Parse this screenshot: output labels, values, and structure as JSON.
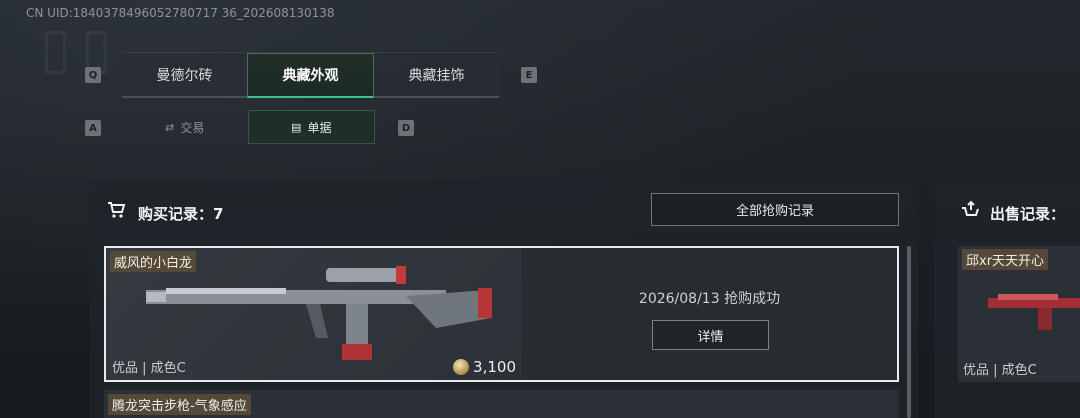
{
  "uid": "CN UID 1840378496052780717 36_202608130138",
  "uid_text": "CN UID:1840378496052780717 36_202608130138",
  "keys": {
    "q": "Q",
    "e": "E",
    "a": "A",
    "d": "D"
  },
  "tabs": [
    {
      "label": "曼德尔砖"
    },
    {
      "label": "典藏外观"
    },
    {
      "label": "典藏挂饰"
    }
  ],
  "subtabs": [
    {
      "label": "交易",
      "icon": "trade-icon"
    },
    {
      "label": "单据",
      "icon": "document-icon"
    }
  ],
  "purchase": {
    "title": "购买记录：7",
    "all_button": "全部抢购记录",
    "records": [
      {
        "name": "威风的小白龙",
        "quality": "优品 | 成色C",
        "price": "3,100",
        "status": "2026/08/13 抢购成功",
        "detail": "详情"
      },
      {
        "name": "腾龙突击步枪-气象感应"
      }
    ]
  },
  "sale": {
    "title": "出售记录：",
    "records": [
      {
        "name": "邱xr天天开心",
        "quality": "优品 | 成色C"
      }
    ]
  }
}
